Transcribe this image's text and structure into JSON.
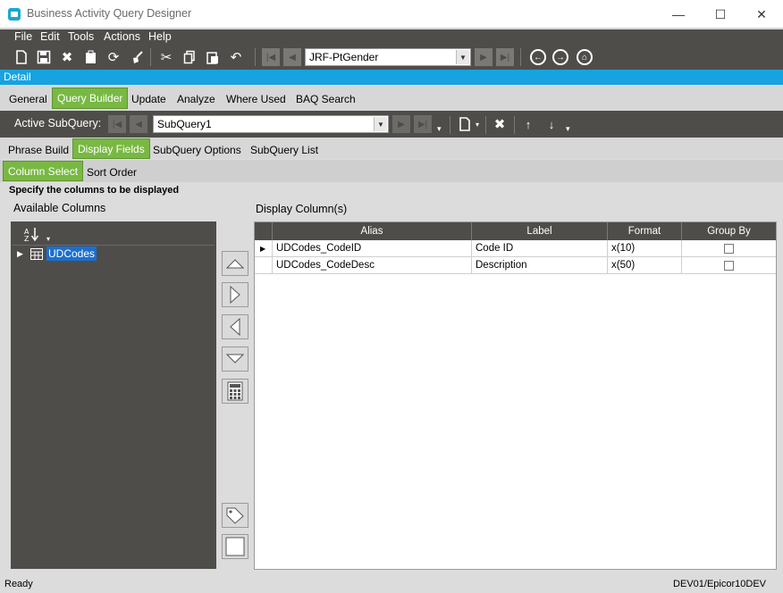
{
  "window": {
    "title": "Business Activity Query Designer",
    "minimize": "—",
    "maximize": "☐",
    "close": "✕"
  },
  "menu": [
    "File",
    "Edit",
    "Tools",
    "Actions",
    "Help"
  ],
  "toolbar": {
    "query_id": "JRF-PtGender"
  },
  "detail_label": "Detail",
  "main_tabs": [
    {
      "label": "General",
      "active": false
    },
    {
      "label": "Query Builder",
      "active": true
    },
    {
      "label": "Update",
      "active": false
    },
    {
      "label": "Analyze",
      "active": false
    },
    {
      "label": "Where Used",
      "active": false
    },
    {
      "label": "BAQ Search",
      "active": false
    }
  ],
  "subquery": {
    "label": "Active SubQuery:",
    "value": "SubQuery1"
  },
  "sub_tabs": [
    {
      "label": "Phrase Build",
      "active": false
    },
    {
      "label": "Display Fields",
      "active": true
    },
    {
      "label": "SubQuery Options",
      "active": false
    },
    {
      "label": "SubQuery List",
      "active": false
    }
  ],
  "inner_tabs": [
    {
      "label": "Column Select",
      "active": true
    },
    {
      "label": "Sort Order",
      "active": false
    }
  ],
  "instructions": "Specify the columns to be displayed",
  "available": {
    "title": "Available Columns",
    "tree_items": [
      "UDCodes"
    ]
  },
  "display": {
    "title": "Display Column(s)",
    "columns": [
      "Alias",
      "Label",
      "Format",
      "Group By"
    ],
    "rows": [
      {
        "alias": "UDCodes_CodeID",
        "label": "Code ID",
        "format": "x(10)",
        "group_by": false,
        "current": true
      },
      {
        "alias": "UDCodes_CodeDesc",
        "label": "Description",
        "format": "x(50)",
        "group_by": false,
        "current": false
      }
    ]
  },
  "status": {
    "left": "Ready",
    "right": "DEV01/Epicor10DEV"
  }
}
